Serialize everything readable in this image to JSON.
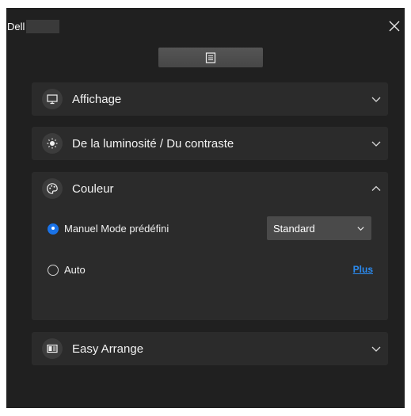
{
  "app": {
    "brand": "Dell",
    "close_icon": "close-icon"
  },
  "menu_tab": {
    "icon": "menu-list-icon"
  },
  "sections": {
    "display": {
      "title": "Affichage",
      "icon": "monitor-icon",
      "expanded": false
    },
    "brightness": {
      "title": "De la luminosité / Du contraste",
      "icon": "brightness-icon",
      "expanded": false
    },
    "color": {
      "title": "Couleur",
      "icon": "palette-icon",
      "expanded": true,
      "manual_label": "Manuel Mode prédéfini",
      "manual_selected": true,
      "preset_value": "Standard",
      "auto_label": "Auto",
      "auto_selected": false,
      "more_link": "Plus"
    },
    "easy_arrange": {
      "title": "Easy Arrange",
      "icon": "easy-arrange-icon",
      "expanded": false
    }
  },
  "colors": {
    "background": "#202020",
    "card": "#2b2b2b",
    "accent": "#1a73e8",
    "link": "#2b8bf0"
  }
}
